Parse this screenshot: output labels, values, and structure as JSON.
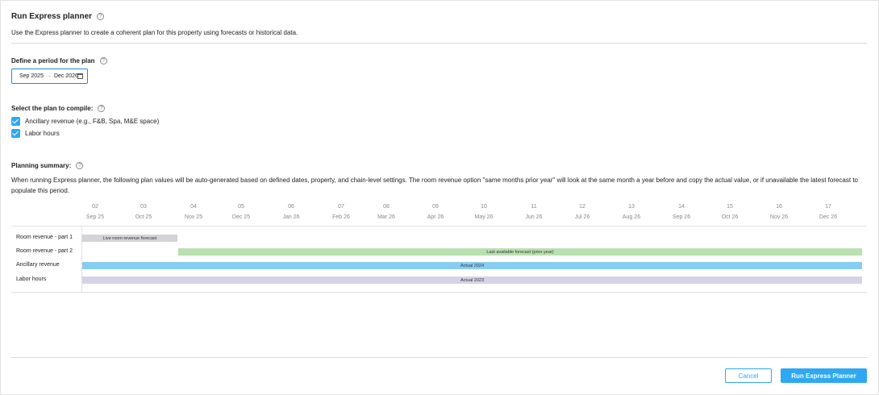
{
  "dialog": {
    "title": "Run Express planner",
    "description": "Use the Express planner to create a coherent plan for this property using forecasts or historical data."
  },
  "period": {
    "label": "Define a period for the plan",
    "start": "Sep 2025",
    "separator": "→",
    "end": "Dec 2026"
  },
  "plans": {
    "label": "Select the plan to compile:",
    "items": [
      {
        "label": "Ancillary revenue (e.g., F&B, Spa, M&E space)",
        "checked": true
      },
      {
        "label": "Labor hours",
        "checked": true
      }
    ]
  },
  "summary": {
    "label": "Planning summary:",
    "text": "When running Express planner, the following plan values will be auto-generated based on defined dates, property, and chain-level settings. The room revenue option \"same months prior year\" will look at the same month a year before and copy the actual value, or if unavailable the latest forecast to populate this period."
  },
  "timeline": {
    "ticks": [
      {
        "num": "02",
        "month": "Sep 25"
      },
      {
        "num": "03",
        "month": "Oct 25"
      },
      {
        "num": "04",
        "month": "Nov 25"
      },
      {
        "num": "05",
        "month": "Dec 25"
      },
      {
        "num": "06",
        "month": "Jan 26"
      },
      {
        "num": "07",
        "month": "Feb 26"
      },
      {
        "num": "08",
        "month": "Mar 26"
      },
      {
        "num": "09",
        "month": "Apr 26"
      },
      {
        "num": "10",
        "month": "May 26"
      },
      {
        "num": "11",
        "month": "Jun 26"
      },
      {
        "num": "12",
        "month": "Jul 26"
      },
      {
        "num": "13",
        "month": "Aug 26"
      },
      {
        "num": "14",
        "month": "Sep 26"
      },
      {
        "num": "15",
        "month": "Oct 26"
      },
      {
        "num": "16",
        "month": "Nov 26"
      },
      {
        "num": "17",
        "month": "Dec 26"
      }
    ],
    "rows": [
      {
        "label": "Room revenue - part 1",
        "bar_label": "Live room revenue forecast",
        "color": "#d3d3d8"
      },
      {
        "label": "Room revenue - part 2",
        "bar_label": "Last available forecast (prior year)",
        "color": "#b9e0b0"
      },
      {
        "label": "Ancillary revenue",
        "bar_label": "Actual 2024",
        "color": "#87cdf2"
      },
      {
        "label": "Labor hours",
        "bar_label": "Actual 2023",
        "color": "#d6d3e8"
      }
    ]
  },
  "buttons": {
    "cancel": "Cancel",
    "run": "Run Express Planner"
  },
  "colors": {
    "accent": "#2ea8f0"
  }
}
